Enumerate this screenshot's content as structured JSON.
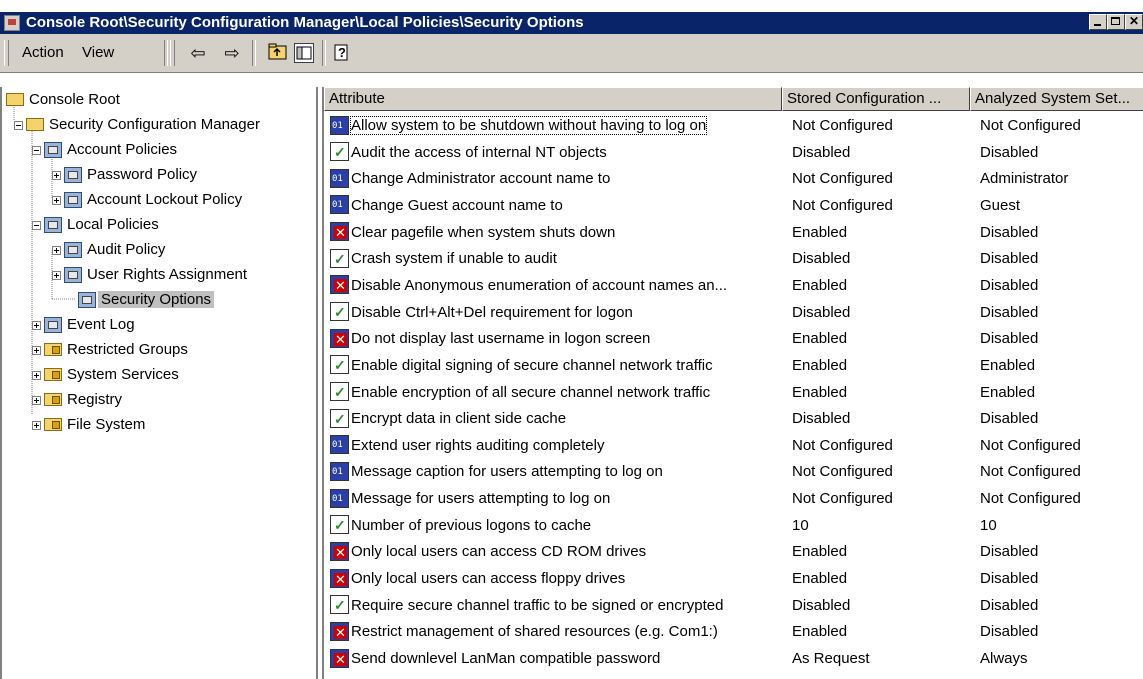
{
  "window": {
    "title": "Console Root\\Security Configuration Manager\\Local Policies\\Security Options"
  },
  "toolbar": {
    "action_label": "Action",
    "view_label": "View"
  },
  "tree": [
    {
      "label": "Console Root",
      "icon": "folder-icon"
    },
    {
      "label": "Security Configuration Manager",
      "icon": "folder-icon"
    },
    {
      "label": "Account Policies",
      "icon": "policy-icon"
    },
    {
      "label": "Password Policy",
      "icon": "policy-icon"
    },
    {
      "label": "Account Lockout Policy",
      "icon": "policy-icon"
    },
    {
      "label": "Local Policies",
      "icon": "policy-icon"
    },
    {
      "label": "Audit Policy",
      "icon": "policy-icon"
    },
    {
      "label": "User Rights Assignment",
      "icon": "policy-icon"
    },
    {
      "label": "Security Options",
      "icon": "policy-icon"
    },
    {
      "label": "Event Log",
      "icon": "policy-icon"
    },
    {
      "label": "Restricted Groups",
      "icon": "lock-folder-icon"
    },
    {
      "label": "System Services",
      "icon": "lock-folder-icon"
    },
    {
      "label": "Registry",
      "icon": "lock-folder-icon"
    },
    {
      "label": "File System",
      "icon": "lock-folder-icon"
    }
  ],
  "columns": [
    "Attribute",
    "Stored Configuration ...",
    "Analyzed System Set..."
  ],
  "rows": [
    {
      "attribute": "Allow system to be shutdown without having to log on",
      "stored": "Not Configured",
      "analyzed": "Not Configured",
      "icon": "not-configured-icon"
    },
    {
      "attribute": "Audit the access of internal NT objects",
      "stored": "Disabled",
      "analyzed": "Disabled",
      "icon": "match-icon"
    },
    {
      "attribute": "Change Administrator account name to",
      "stored": "Not Configured",
      "analyzed": "Administrator",
      "icon": "not-configured-icon"
    },
    {
      "attribute": "Change Guest account name to",
      "stored": "Not Configured",
      "analyzed": "Guest",
      "icon": "not-configured-icon"
    },
    {
      "attribute": "Clear pagefile when system shuts down",
      "stored": "Enabled",
      "analyzed": "Disabled",
      "icon": "mismatch-icon"
    },
    {
      "attribute": "Crash system if unable to audit",
      "stored": "Disabled",
      "analyzed": "Disabled",
      "icon": "match-icon"
    },
    {
      "attribute": "Disable Anonymous enumeration of account names an...",
      "stored": "Enabled",
      "analyzed": "Disabled",
      "icon": "mismatch-icon"
    },
    {
      "attribute": "Disable Ctrl+Alt+Del requirement for logon",
      "stored": "Disabled",
      "analyzed": "Disabled",
      "icon": "match-icon"
    },
    {
      "attribute": "Do not display last username in logon screen",
      "stored": "Enabled",
      "analyzed": "Disabled",
      "icon": "mismatch-icon"
    },
    {
      "attribute": "Enable digital signing of secure channel network traffic",
      "stored": "Enabled",
      "analyzed": "Enabled",
      "icon": "match-icon"
    },
    {
      "attribute": "Enable encryption of all secure channel network traffic",
      "stored": "Enabled",
      "analyzed": "Enabled",
      "icon": "match-icon"
    },
    {
      "attribute": "Encrypt data in client side cache",
      "stored": "Disabled",
      "analyzed": "Disabled",
      "icon": "match-icon"
    },
    {
      "attribute": "Extend user rights auditing completely",
      "stored": "Not Configured",
      "analyzed": "Not Configured",
      "icon": "not-configured-icon"
    },
    {
      "attribute": "Message caption for users attempting to log on",
      "stored": "Not Configured",
      "analyzed": "Not Configured",
      "icon": "not-configured-icon"
    },
    {
      "attribute": "Message for users attempting to log on",
      "stored": "Not Configured",
      "analyzed": "Not Configured",
      "icon": "not-configured-icon"
    },
    {
      "attribute": "Number of previous logons to cache",
      "stored": "10",
      "analyzed": "10",
      "icon": "match-icon"
    },
    {
      "attribute": "Only local users can access CD ROM drives",
      "stored": "Enabled",
      "analyzed": "Disabled",
      "icon": "mismatch-icon"
    },
    {
      "attribute": "Only local users can access floppy drives",
      "stored": "Enabled",
      "analyzed": "Disabled",
      "icon": "mismatch-icon"
    },
    {
      "attribute": "Require secure channel traffic to be signed or encrypted",
      "stored": "Disabled",
      "analyzed": "Disabled",
      "icon": "match-icon"
    },
    {
      "attribute": "Restrict management of shared resources (e.g. Com1:)",
      "stored": "Enabled",
      "analyzed": "Disabled",
      "icon": "mismatch-icon"
    },
    {
      "attribute": "Send downlevel LanMan compatible password",
      "stored": "As Request",
      "analyzed": "Always",
      "icon": "mismatch-icon"
    }
  ]
}
